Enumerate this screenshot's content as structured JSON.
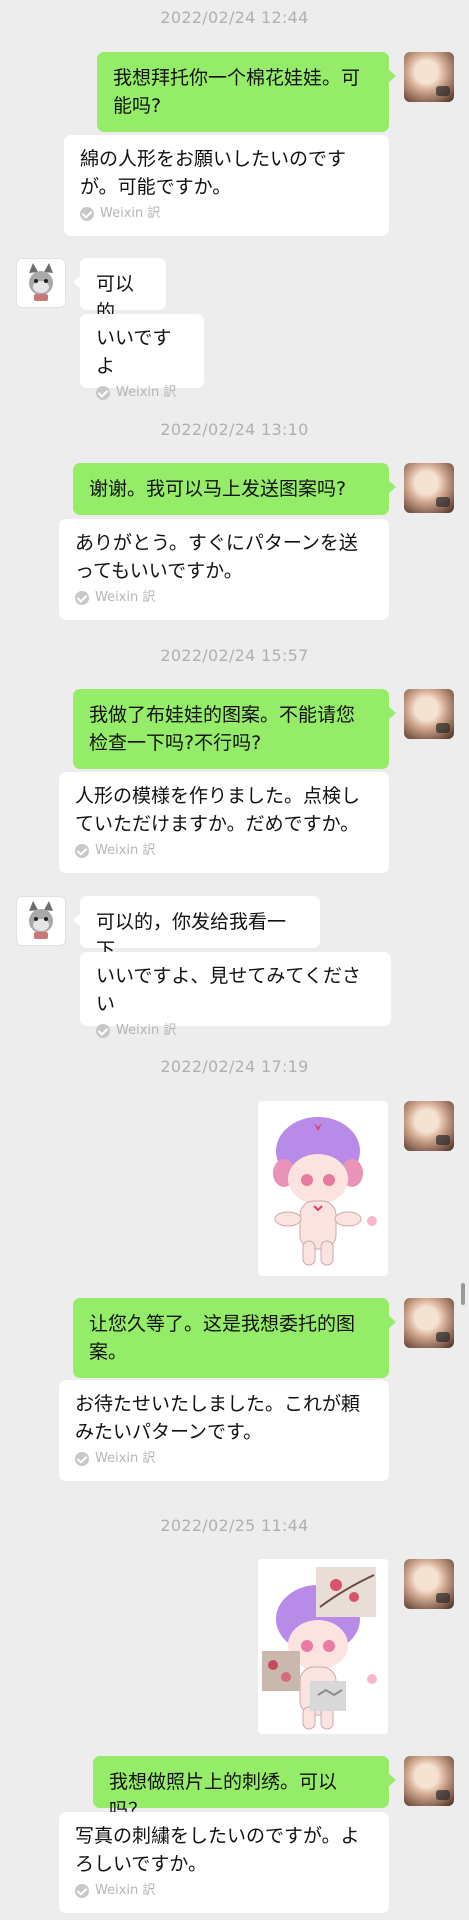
{
  "messages": [
    {
      "timestamp": "2022/02/24 12:44"
    },
    {
      "text": "我想拜托你一个棉花娃娃。可能吗?",
      "translation": "綿の人形をお願いしたいのですが。可能ですか。",
      "tag": "Weixin 訳"
    },
    {
      "text": "可以的",
      "translation": "いいですよ",
      "tag": "Weixin 訳"
    },
    {
      "timestamp": "2022/02/24 13:10"
    },
    {
      "text": "谢谢。我可以马上发送图案吗?",
      "translation": "ありがとう。すぐにパターンを送ってもいいですか。",
      "tag": "Weixin 訳"
    },
    {
      "timestamp": "2022/02/24 15:57"
    },
    {
      "text": "我做了布娃娃的图案。不能请您检查一下吗?不行吗?",
      "translation": "人形の模様を作りました。点検していただけますか。だめですか。",
      "tag": "Weixin 訳"
    },
    {
      "text": "可以的，你发给我看一下",
      "translation": "いいですよ、見せてみてください",
      "tag": "Weixin 訳"
    },
    {
      "timestamp": "2022/02/24 17:19"
    },
    {
      "image": "doll-pattern-image"
    },
    {
      "text": "让您久等了。这是我想委托的图案。",
      "translation": "お待たせいたしました。これが頼みたいパターンです。",
      "tag": "Weixin 訳"
    },
    {
      "timestamp": "2022/02/25 11:44"
    },
    {
      "image": "doll-embroidery-collage-image"
    },
    {
      "text": "我想做照片上的刺绣。可以吗？",
      "translation": "写真の刺繍をしたいのですが。よろしいですか。",
      "tag": "Weixin 訳"
    }
  ],
  "colors": {
    "sent_bubble": "#95ec69",
    "received_bubble": "#ffffff",
    "background": "#ededed",
    "timestamp": "#b0b0b0"
  }
}
